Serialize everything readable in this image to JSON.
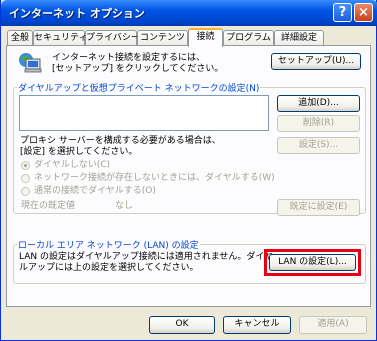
{
  "window": {
    "title": "インターネット オプション",
    "help_label": "?",
    "close_label": "×"
  },
  "tabs": [
    {
      "label": "全般"
    },
    {
      "label": "セキュリティ"
    },
    {
      "label": "プライバシー"
    },
    {
      "label": "コンテンツ"
    },
    {
      "label": "接続"
    },
    {
      "label": "プログラム"
    },
    {
      "label": "詳細設定"
    }
  ],
  "setup": {
    "line1": "インターネット接続を設定するには、",
    "line2": "[セットアップ] をクリックしてください。",
    "button": "セットアップ(U)..."
  },
  "dialup": {
    "legend": "ダイヤルアップと仮想プライベート ネットワークの設定(N)",
    "add_button": "追加(D)...",
    "remove_button": "削除(R)",
    "settings_button": "設定(S)...",
    "proxy_line1": "プロキシ サーバーを構成する必要がある場合は、",
    "proxy_line2": "[設定] を選択してください。",
    "radio_never": "ダイヤルしない(C)",
    "radio_when_absent": "ネットワーク接続が存在しないときには、ダイヤルする(W)",
    "radio_always": "通常の接続でダイヤルする(O)",
    "current_default_label": "現在の既定値",
    "current_default_value": "なし",
    "set_default_button": "既定に設定(E)"
  },
  "lan": {
    "legend": "ローカル エリア ネットワーク (LAN) の設定",
    "line1": "LAN の設定はダイヤルアップ接続には適用されません。ダイヤ",
    "line2": "ルアップには上の設定を選択してください。",
    "button": "LAN の設定(L)..."
  },
  "footer": {
    "ok": "OK",
    "cancel": "キャンセル",
    "apply": "適用(A)"
  },
  "highlight_color": "#e60012"
}
